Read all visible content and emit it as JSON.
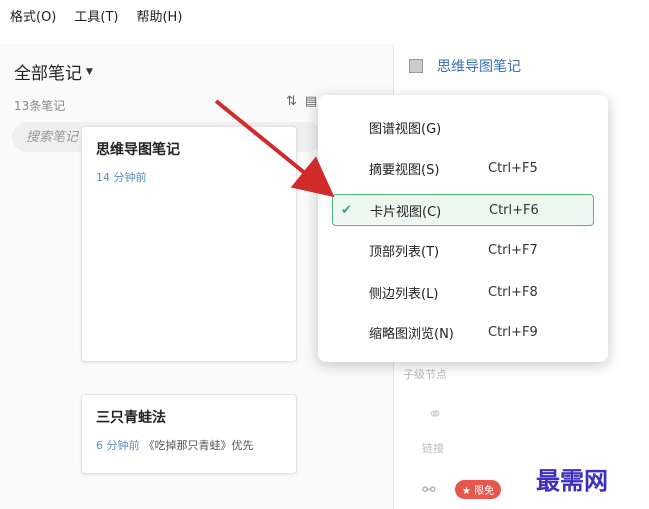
{
  "menubar": {
    "items": [
      {
        "label": "格式(O)"
      },
      {
        "label": "工具(T)"
      },
      {
        "label": "帮助(H)"
      }
    ]
  },
  "notes_panel": {
    "title": "全部笔记",
    "count": "13条笔记",
    "search_placeholder": "搜索笔记"
  },
  "cards": [
    {
      "title": "思维导图笔记",
      "time": "14 分钟前",
      "snippet": ""
    },
    {
      "title": "三只青蛙法",
      "time": "6 分钟前",
      "snippet": "《吃掉那只青蛙》优先"
    }
  ],
  "note_detail": {
    "title": "思维导图笔记",
    "tools": {
      "child_node": "子级节点",
      "link": "链接",
      "badge": "★ 限免"
    }
  },
  "view_menu": {
    "items": [
      {
        "label": "图谱视图(G)",
        "shortcut": "",
        "checked": false
      },
      {
        "label": "摘要视图(S)",
        "shortcut": "Ctrl+F5",
        "checked": false
      },
      {
        "label": "卡片视图(C)",
        "shortcut": "Ctrl+F6",
        "checked": true
      },
      {
        "label": "顶部列表(T)",
        "shortcut": "Ctrl+F7",
        "checked": false
      },
      {
        "label": "侧边列表(L)",
        "shortcut": "Ctrl+F8",
        "checked": false
      },
      {
        "label": "缩略图浏览(N)",
        "shortcut": "Ctrl+F9",
        "checked": false
      }
    ]
  },
  "watermark": "最需网",
  "colors": {
    "accent": "#3a6fb5",
    "check": "#3da46b",
    "arrow": "#d12a2a"
  }
}
